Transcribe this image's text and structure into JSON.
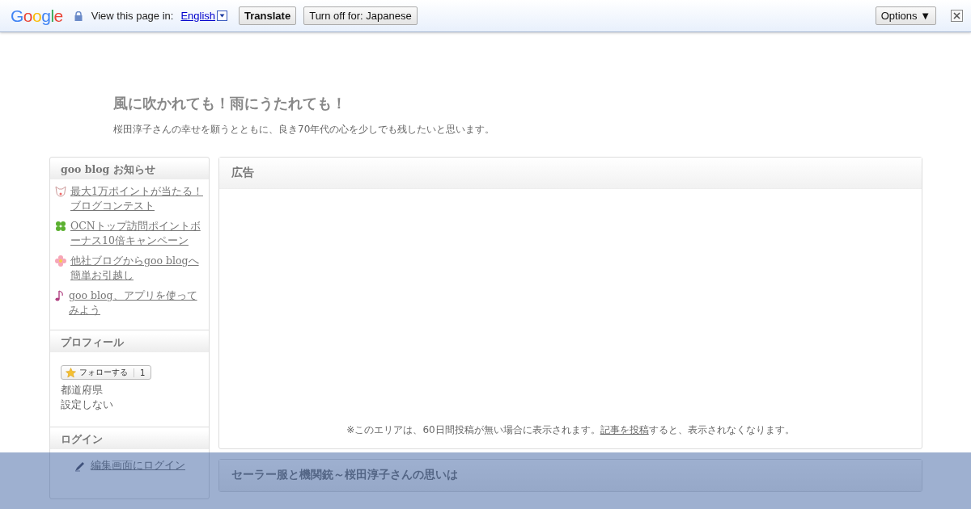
{
  "translate_bar": {
    "logo": "Google",
    "prompt": "View this page in:",
    "language": "English",
    "translate_button": "Translate",
    "turn_off_button": "Turn off for: Japanese",
    "options_button": "Options ▼"
  },
  "blog": {
    "title": "風に吹かれても！雨にうたれても！",
    "description": "桜田淳子さんの幸せを願うとともに、良き70年代の心を少しでも残したいと思います。"
  },
  "sidebar": {
    "notices": {
      "title": "goo blog お知らせ",
      "items": [
        {
          "kind": "cat",
          "text": "最大1万ポイントが当たる！ブログコンテスト"
        },
        {
          "kind": "clover",
          "text": "OCNトップ訪問ポイントボーナス10倍キャンペーン"
        },
        {
          "kind": "flower",
          "text": "他社ブログからgoo blogへ簡単お引越し"
        },
        {
          "kind": "note",
          "text": "goo blog、アプリを使ってみよう"
        }
      ]
    },
    "profile": {
      "title": "プロフィール",
      "follow_label": "フォローする",
      "follow_count": "1",
      "prefecture_label": "都道府県",
      "prefecture_value": "設定しない"
    },
    "login": {
      "title": "ログイン",
      "link": "編集画面にログイン"
    }
  },
  "ad": {
    "title": "広告",
    "notice_before": "※このエリアは、60日間投稿が無い場合に表示されます。",
    "notice_link": "記事を投稿",
    "notice_after": "すると、表示されなくなります。"
  },
  "article": {
    "title": "セーラー服と機関銃～桜田淳子さんの思いは"
  }
}
